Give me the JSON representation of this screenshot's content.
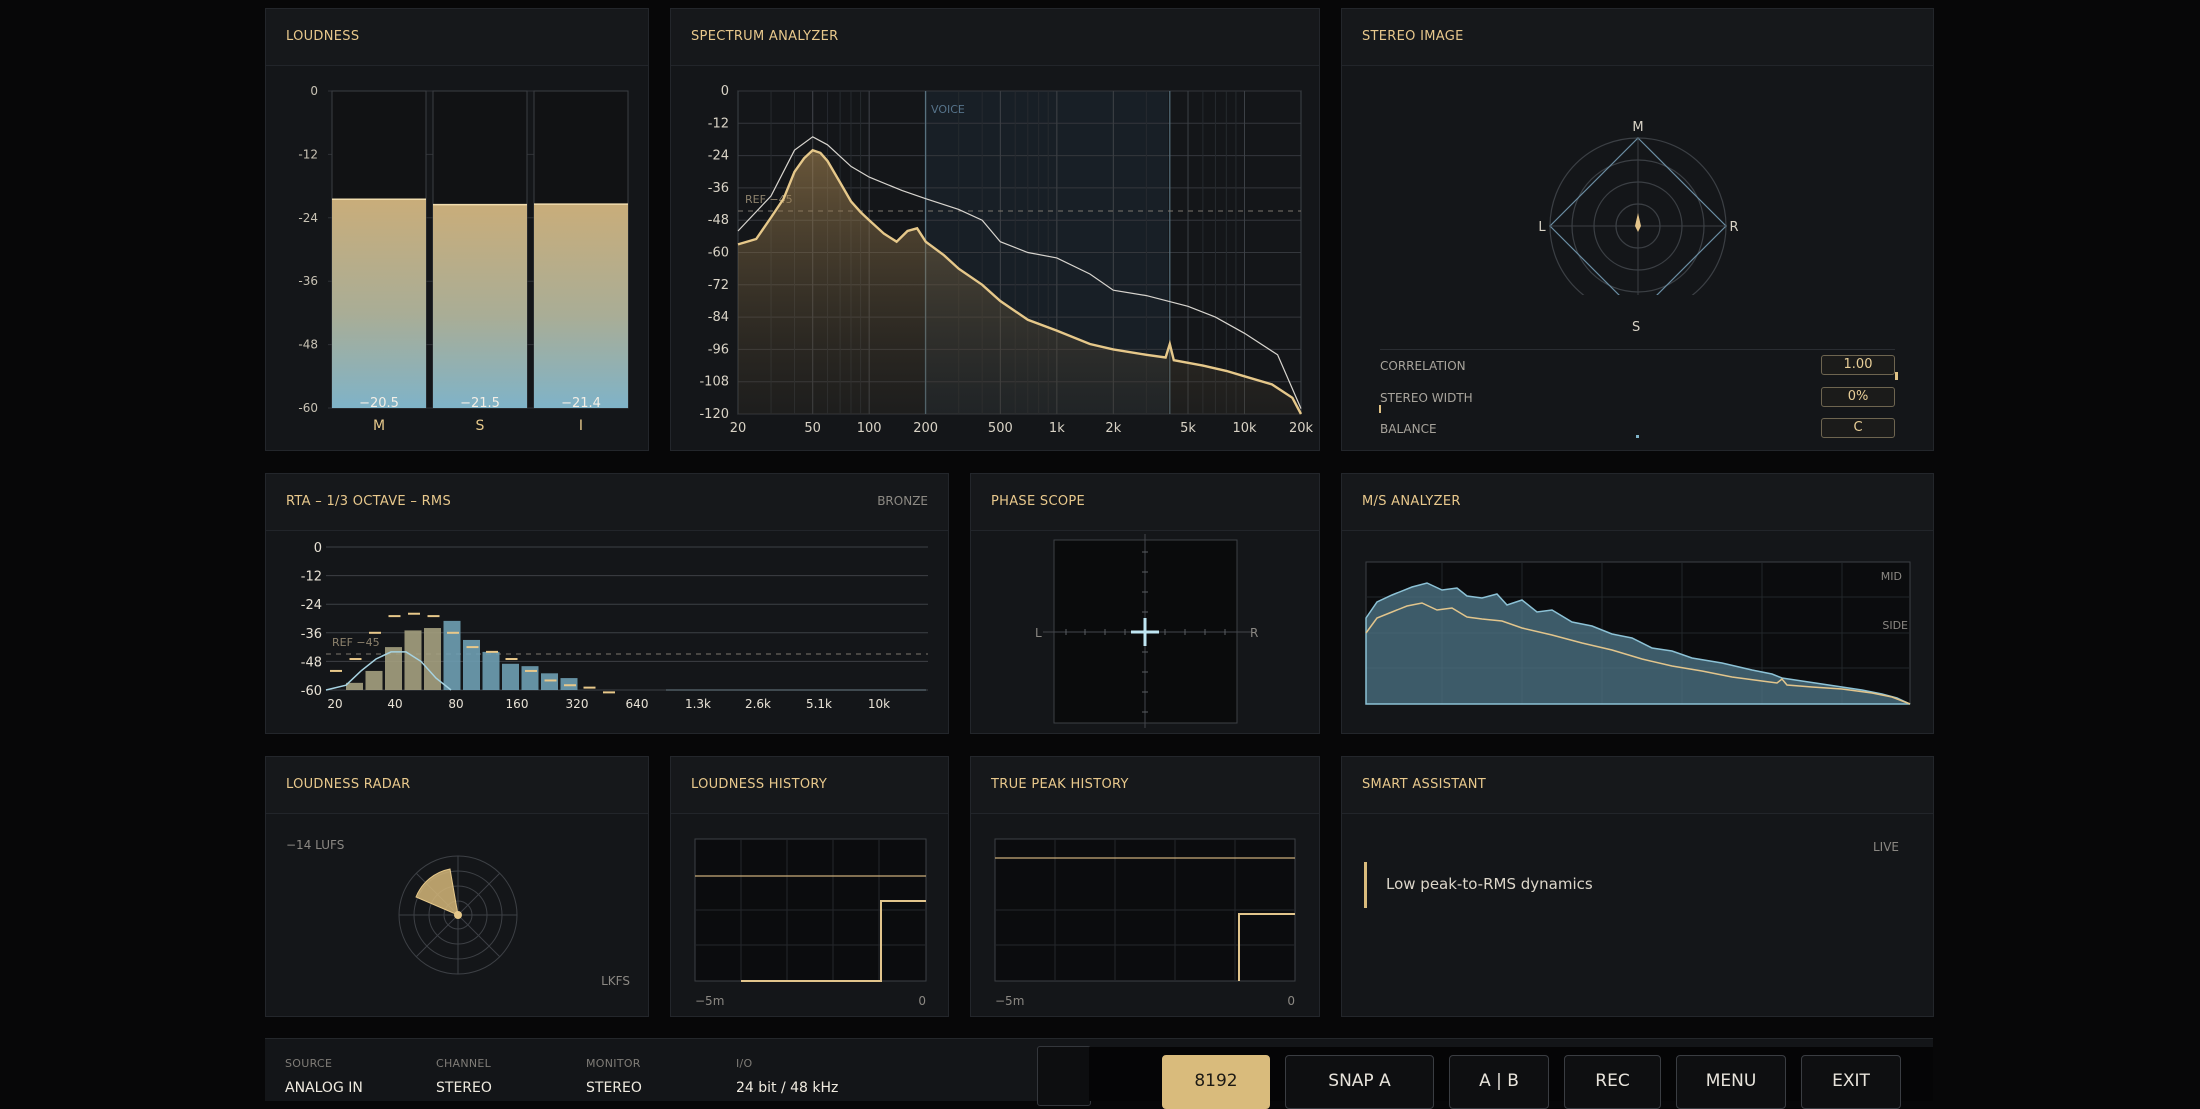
{
  "panels": {
    "loudness": {
      "title": "LOUDNESS"
    },
    "spectrum": {
      "title": "SPECTRUM ANALYZER"
    },
    "stereo": {
      "title": "STEREO IMAGE"
    },
    "rta": {
      "title": "RTA – 1/3 OCTAVE – RMS",
      "tag": "BRONZE"
    },
    "phase": {
      "title": "PHASE SCOPE"
    },
    "ms": {
      "title": "M/S ANALYZER"
    },
    "radar": {
      "title": "LOUDNESS RADAR"
    },
    "history": {
      "title": "LOUDNESS HISTORY"
    },
    "truepeak": {
      "title": "TRUE PEAK HISTORY"
    },
    "assistant": {
      "title": "SMART ASSISTANT"
    }
  },
  "loudness": {
    "y_ticks": [
      "0",
      "-12",
      "-24",
      "-36",
      "-48",
      "-60"
    ],
    "bars": [
      {
        "label": "M",
        "value": -20.5,
        "text": "−20.5"
      },
      {
        "label": "S",
        "value": -21.5,
        "text": "−21.5"
      },
      {
        "label": "I",
        "value": -21.4,
        "text": "−21.4"
      }
    ],
    "ymin": -60,
    "ymax": 0
  },
  "spectrum": {
    "y_ticks": [
      "0",
      "-12",
      "-24",
      "-36",
      "-48",
      "-60",
      "-72",
      "-84",
      "-96",
      "-108",
      "-120"
    ],
    "x_ticks": [
      "20",
      "50",
      "100",
      "200",
      "500",
      "1k",
      "2k",
      "5k",
      "10k",
      "20k"
    ],
    "ref_label": "REF −45",
    "voice_label": "VOICE"
  },
  "stereo": {
    "labels": {
      "top": "M",
      "bottom": "S",
      "left": "L",
      "right": "R"
    },
    "rows": [
      {
        "name": "CORRELATION",
        "value": "1.00"
      },
      {
        "name": "STEREO WIDTH",
        "value": "0%"
      },
      {
        "name": "BALANCE",
        "value": "C"
      }
    ]
  },
  "rta": {
    "y_ticks": [
      "0",
      "-12",
      "-24",
      "-36",
      "-48",
      "-60"
    ],
    "x_ticks": [
      "20",
      "40",
      "80",
      "160",
      "320",
      "640",
      "1.3k",
      "2.6k",
      "5.1k",
      "10k"
    ],
    "ref_label": "REF −45"
  },
  "phase": {
    "left": "L",
    "right": "R"
  },
  "ms": {
    "mid": "MID",
    "side": "SIDE"
  },
  "radar": {
    "target": "−14 LUFS",
    "unit": "LKFS"
  },
  "history": {
    "x_start": "−5m",
    "x_end": "0"
  },
  "truepeak": {
    "x_start": "−5m",
    "x_end": "0"
  },
  "assistant": {
    "status": "LIVE",
    "message": "Low peak-to-RMS dynamics"
  },
  "footer": {
    "source": {
      "key": "SOURCE",
      "value": "ANALOG IN"
    },
    "channel": {
      "key": "CHANNEL",
      "value": "STEREO"
    },
    "monitor": {
      "key": "MONITOR",
      "value": "STEREO"
    },
    "io": {
      "key": "I/O",
      "value": "24 bit / 48 kHz"
    },
    "buttons": {
      "fft": "8192",
      "snap": "SNAP A",
      "ab": "A | B",
      "rec": "REC",
      "menu": "MENU",
      "exit": "EXIT"
    }
  },
  "colors": {
    "accent": "#e8c88c",
    "gold": "#d9bb7c",
    "blue": "#7fb3c8"
  }
}
